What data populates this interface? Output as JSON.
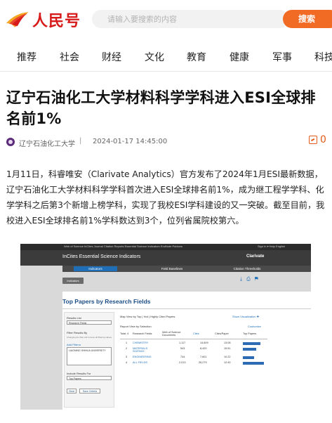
{
  "header": {
    "logo_text": "人民号",
    "search_placeholder": "请输入要搜索的内容",
    "search_button": "搜索",
    "brand_color": "#d71a1a",
    "accent_color": "#f26b25"
  },
  "nav": {
    "items": [
      {
        "label": "推荐"
      },
      {
        "label": "社会"
      },
      {
        "label": "财经"
      },
      {
        "label": "文化"
      },
      {
        "label": "教育"
      },
      {
        "label": "健康"
      },
      {
        "label": "军事"
      },
      {
        "label": "科技"
      }
    ]
  },
  "article": {
    "title": "辽宁石油化工大学材料科学学科进入ESI全球排名前1%",
    "source": "辽宁石油化工大学",
    "separator": "|",
    "date": "2024-01-17 14:45:00",
    "comment_count": "0",
    "body": "1月11日，科睿唯安（Clarivate Analytics）官方发布了2024年1月ESI最新数据，辽宁石油化工大学材料科学学科首次进入ESI全球排名前1%，成为继工程学学科、化学学科之后第3个新增上榜学科，实现了我校ESI学科建设的又一突破。截至目前，我校进入ESI全球排名前1%学科数达到3个，位列省属院校第六。"
  },
  "screenshot": {
    "top_links": "Web of Science    InCites    Journal Citation Reports    Essential Science Indicators    EndNote    Publons",
    "signin": "Sign In ▾    Help    English",
    "brand": "InCites Essential Science Indicators",
    "vendor": "Clarivate",
    "tabs": [
      "Indicators",
      "Field Baselines",
      "Citation Thresholds"
    ],
    "crumb": "Indicators",
    "panel_title": "Top Papers by Research Fields",
    "results_list_label": "Results List",
    "results_list_value": "Research Fields",
    "filter_label": "Filter Results By",
    "filter_hint": "Changing the filter will remove all filtering values",
    "add_filter": "Add Filter ▸",
    "filter_box": "LIAONING SHIHUA UNIVERSITY",
    "include_label": "Include Results For",
    "include_value": "Top Papers",
    "clear_btn": "Clear",
    "save_btn": "Save Criteria",
    "map_view": "Map View by Top | Hot | Highly Cited Papers",
    "show_viz": "Show Visualization ✚",
    "report_view": "Report View by Selection",
    "customize": "Customize",
    "columns": [
      "Total: 4",
      "Research Fields",
      "Web of Science Documents",
      "Cites",
      "Cites/Paper",
      "Top Papers"
    ],
    "rows": [
      {
        "n": "1",
        "field": "CHEMISTRY",
        "docs": "1,117",
        "cites": "14,609",
        "cpp": "13.08",
        "top": "8"
      },
      {
        "n": "2",
        "field": "MATERIALS SCIENCE",
        "docs": "543",
        "cites": "8,420",
        "cpp": "15.51",
        "top": "6"
      },
      {
        "n": "3",
        "field": "ENGINEERING",
        "docs": "744",
        "cites": "7,601",
        "cpp": "10.22",
        "top": "5"
      },
      {
        "n": "4",
        "field": "ALL FIELDS",
        "docs": "2,013",
        "cites": "26,279",
        "cpp": "12.90",
        "top": "21"
      }
    ]
  }
}
